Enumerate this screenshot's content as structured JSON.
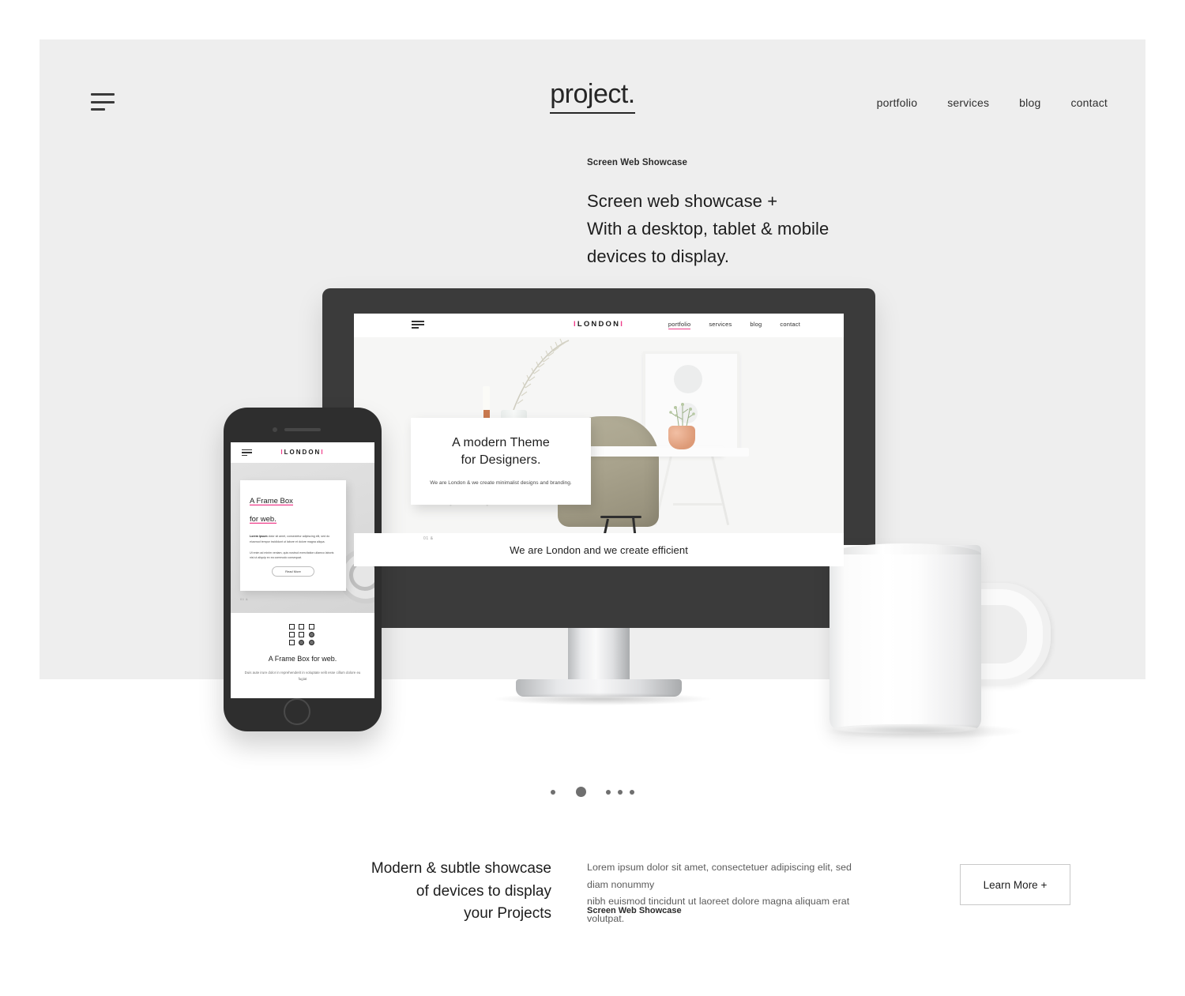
{
  "header": {
    "logo": "project.",
    "menu_icon": "hamburger-icon",
    "nav": [
      {
        "label": "portfolio"
      },
      {
        "label": "services"
      },
      {
        "label": "blog"
      },
      {
        "label": "contact"
      }
    ]
  },
  "hero": {
    "eyebrow": "Screen Web Showcase",
    "line1": "Screen web showcase +",
    "line2": "With a desktop, tablet & mobile",
    "line3": "devices to display."
  },
  "desktop_mockup": {
    "site_logo_left_bracket": "I",
    "site_logo": "LONDON",
    "site_logo_right_bracket": "I",
    "nav": [
      {
        "label": "portfolio",
        "active": true
      },
      {
        "label": "services",
        "active": false
      },
      {
        "label": "blog",
        "active": false
      },
      {
        "label": "contact",
        "active": false
      }
    ],
    "card": {
      "title_line1": "A modern Theme",
      "title_line2": "for Designers.",
      "body": "We are London & we create minimalist designs and branding."
    },
    "counter": "01 &",
    "tagline": "We are London and we create efficient"
  },
  "phone_mockup": {
    "site_logo_left_bracket": "I",
    "site_logo": "LONDON",
    "site_logo_right_bracket": "I",
    "card": {
      "title_line1": "A Frame Box",
      "title_line2": "for web.",
      "lead": "Lorem ipsum",
      "para1": " dolor sit amet, consectetur adipiscing elit, sed do eiusmod tempor incididunt ut labore et dolore magna aliqua.",
      "para2": "Ut enim ad minim veniam, quis nostrud exercitation ullamco laboris nisi ut aliquip ex ea commodo consequat.",
      "button": "Read More"
    },
    "counter": "01 &",
    "lower": {
      "icon": "grid-3x3-icon",
      "title": "A Frame Box for web.",
      "body": "Duis aute irure dolor in reprehenderit in voluptate velit esse cillum dolore eu fugiat"
    }
  },
  "carousel": {
    "dots": [
      {
        "active": false
      },
      {
        "active": true
      },
      {
        "active": false
      },
      {
        "active": false
      },
      {
        "active": false
      }
    ]
  },
  "bottom": {
    "heading_line1": "Modern & subtle showcase",
    "heading_line2": "of devices to display",
    "heading_line3": "your Projects",
    "body_line1": "Lorem ipsum dolor sit amet, consectetuer adipiscing elit, sed diam nonummy",
    "body_line2": "nibh euismod tincidunt ut laoreet dolore magna aliquam erat volutpat.",
    "label": "Screen Web Showcase",
    "cta": "Learn More +"
  },
  "colors": {
    "panel_bg": "#eeeeee",
    "page_bg": "#ffffff",
    "accent_pink": "#ef3d8a",
    "text_dark": "#1d1d1d",
    "device_dark": "#3b3b3b"
  }
}
